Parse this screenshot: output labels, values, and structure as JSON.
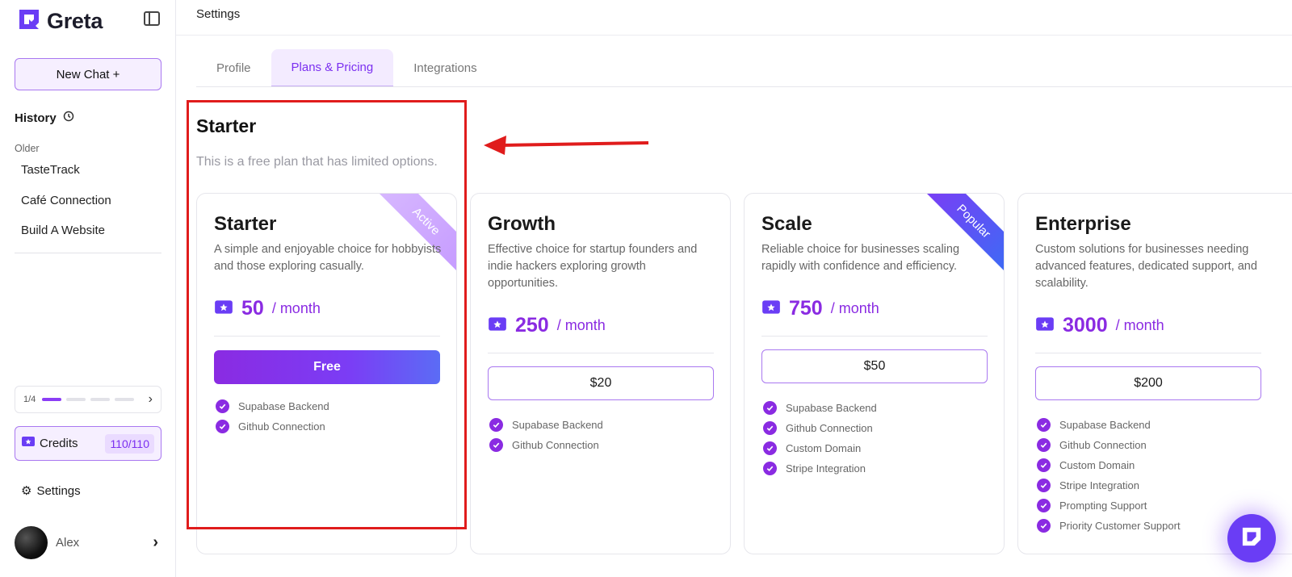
{
  "app": {
    "name": "Greta"
  },
  "sidebar": {
    "new_chat_label": "New Chat +",
    "history_label": "History",
    "older_label": "Older",
    "history_items": [
      "TasteTrack",
      "Café Connection",
      "Build A Website"
    ],
    "progress": {
      "label": "1/4",
      "completed": 1,
      "total": 4
    },
    "credits": {
      "label": "Credits",
      "count": "110/110"
    },
    "settings_label": "Settings",
    "user": {
      "name": "Alex"
    }
  },
  "header": {
    "title": "Settings"
  },
  "tabs": [
    {
      "label": "Profile",
      "active": false
    },
    {
      "label": "Plans & Pricing",
      "active": true
    },
    {
      "label": "Integrations",
      "active": false
    }
  ],
  "section": {
    "title": "Starter",
    "subtitle": "This is a free plan that has limited options."
  },
  "plans": [
    {
      "name": "Starter",
      "description": "A simple and enjoyable choice for hobbyists and those exploring casually.",
      "price": "50",
      "unit": "/ month",
      "button": "Free",
      "ribbon": "Active",
      "features": [
        "Supabase Backend",
        "Github Connection"
      ]
    },
    {
      "name": "Growth",
      "description": "Effective choice for startup founders and indie hackers exploring growth opportunities.",
      "price": "250",
      "unit": "/ month",
      "button": "$20",
      "ribbon": "",
      "features": [
        "Supabase Backend",
        "Github Connection"
      ]
    },
    {
      "name": "Scale",
      "description": "Reliable choice for businesses scaling rapidly with confidence and efficiency.",
      "price": "750",
      "unit": "/ month",
      "button": "$50",
      "ribbon": "Popular",
      "features": [
        "Supabase Backend",
        "Github Connection",
        "Custom Domain",
        "Stripe Integration"
      ]
    },
    {
      "name": "Enterprise",
      "description": "Custom solutions for businesses needing advanced features, dedicated support, and scalability.",
      "price": "3000",
      "unit": "/ month",
      "button": "$200",
      "ribbon": "",
      "features": [
        "Supabase Backend",
        "Github Connection",
        "Custom Domain",
        "Stripe Integration",
        "Prompting Support",
        "Priority Customer Support"
      ]
    }
  ],
  "colors": {
    "accent": "#8a2be2",
    "annotation": "#e01c1c"
  }
}
